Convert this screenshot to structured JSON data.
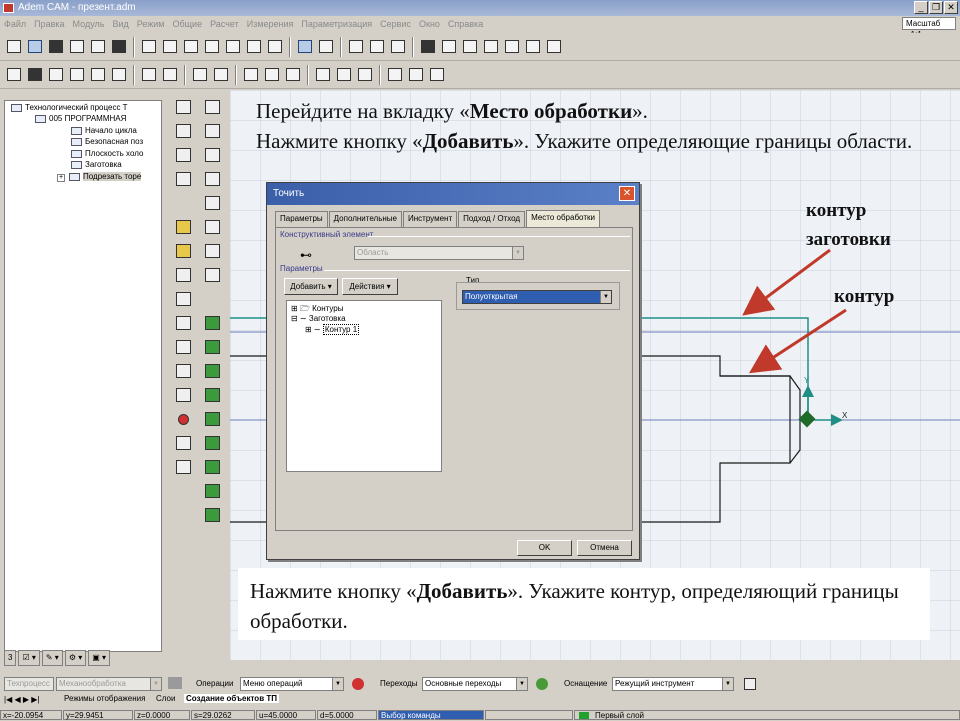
{
  "window": {
    "title": "Adem CAM - презент.adm",
    "zoom_label": "Масштаб =1:1"
  },
  "menu": [
    "Файл",
    "Правка",
    "Модуль",
    "Вид",
    "Режим",
    "Общие",
    "Расчет",
    "Измерения",
    "Параметризация",
    "Сервис",
    "Окно",
    "Справка"
  ],
  "tree": {
    "items": [
      {
        "label": "Технологический процесс Т"
      },
      {
        "label": "005  ПРОГРАММНАЯ"
      },
      {
        "label": "Начало цикла"
      },
      {
        "label": "Безопасная поз"
      },
      {
        "label": "Плоскость холо"
      },
      {
        "label": "Заготовка"
      },
      {
        "label": "Подрезать торе"
      }
    ],
    "tab_number": "3"
  },
  "instructions": {
    "top_part1": "Перейдите на вкладку «",
    "top_bold1": "Место обработки",
    "top_part2": "».",
    "top_line2_a": "Нажмите кнопку «",
    "top_line2_bold": "Добавить",
    "top_line2_b": "». Укажите  определяющие границы области.",
    "bottom_a": "Нажмите кнопку «",
    "bottom_bold": "Добавить",
    "bottom_b": "». Укажите контур, определяющий границы обработки."
  },
  "annotations": {
    "blank_contour": "контур заготовки",
    "contour": "контур"
  },
  "axes": {
    "x": "X",
    "y": "Y"
  },
  "dialog": {
    "title": "Точить",
    "tabs": [
      "Параметры",
      "Дополнительные",
      "Инструмент",
      "Подход / Отход",
      "Место обработки"
    ],
    "active_tab": "Место обработки",
    "group_constructive": "Конструктивный элемент",
    "area_value": "Область",
    "group_params": "Параметры",
    "add_button": "Добавить",
    "actions_button": "Действия",
    "type_label": "Тип",
    "type_value": "Полуоткрытая",
    "tree": [
      "Контуры",
      "Заготовка",
      "Контур 1"
    ],
    "ok": "OK",
    "cancel": "Отмена"
  },
  "bottom": {
    "process_label": "Техпроцесс",
    "process_value": "Механообработка",
    "operations_label": "Операции",
    "operations_value": "Меню операций",
    "transitions_label": "Переходы",
    "transitions_value": "Основные переходы",
    "equipment_label": "Оснащение",
    "equipment_value": "Режущий инструмент",
    "tabs": [
      "Режимы отображения",
      "Слои",
      "Создание объектов ТП"
    ]
  },
  "status": {
    "x": "x=-20.0954",
    "y": "y=29.9451",
    "z": "z=0.0000",
    "s": "s=29.0262",
    "u": "u=45.0000",
    "d": "d=5.0000",
    "mode": "Выбор команды",
    "layer": "Первый слой"
  },
  "colors": {
    "accent": "#3b5fa8",
    "arrow": "#c0392b",
    "grid": "#c8d0dc",
    "part_line": "#1a1a1a",
    "blank_line": "#1f8f86"
  }
}
